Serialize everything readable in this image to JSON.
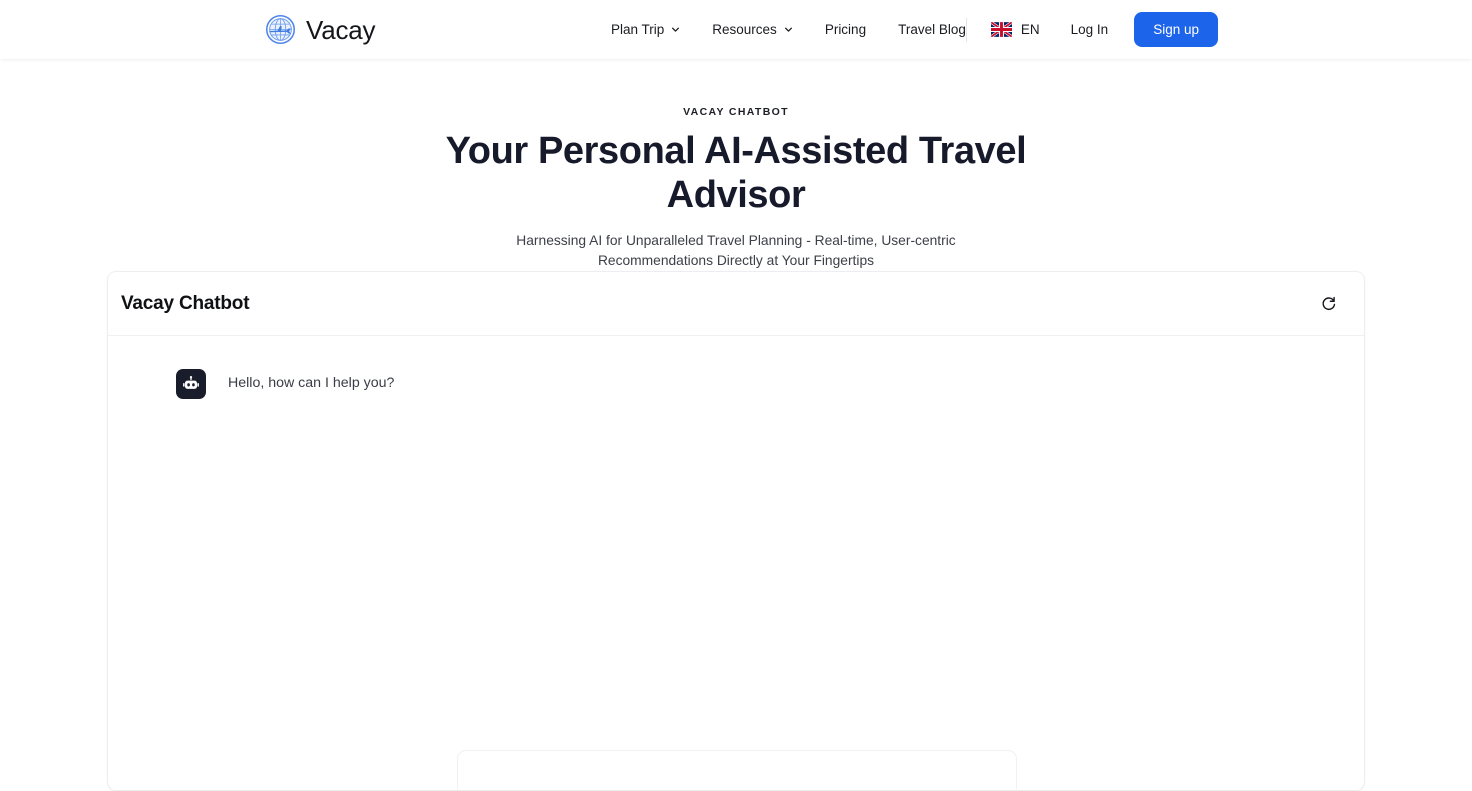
{
  "header": {
    "brand": {
      "name": "Vacay",
      "icon": "globe-plane-logo"
    },
    "nav": [
      {
        "label": "Plan Trip",
        "has_dropdown": true
      },
      {
        "label": "Resources",
        "has_dropdown": true
      },
      {
        "label": "Pricing",
        "has_dropdown": false
      },
      {
        "label": "Travel Blog",
        "has_dropdown": false
      }
    ],
    "language": {
      "code": "EN",
      "flag": "uk-flag-icon"
    },
    "login_label": "Log In",
    "signup_label": "Sign up",
    "accent_color": "#1c64ea"
  },
  "hero": {
    "eyebrow": "VACAY CHATBOT",
    "title": "Your Personal AI-Assisted Travel Advisor",
    "subtitle": "Harnessing AI for Unparalleled Travel Planning - Real-time, User-centric Recommendations Directly at Your Fingertips"
  },
  "chat": {
    "title": "Vacay Chatbot",
    "refresh_icon": "refresh-icon",
    "messages": [
      {
        "role": "bot",
        "avatar": "robot-icon",
        "text": "Hello, how can I help you?"
      }
    ],
    "composer": {
      "value": "",
      "placeholder": ""
    }
  }
}
